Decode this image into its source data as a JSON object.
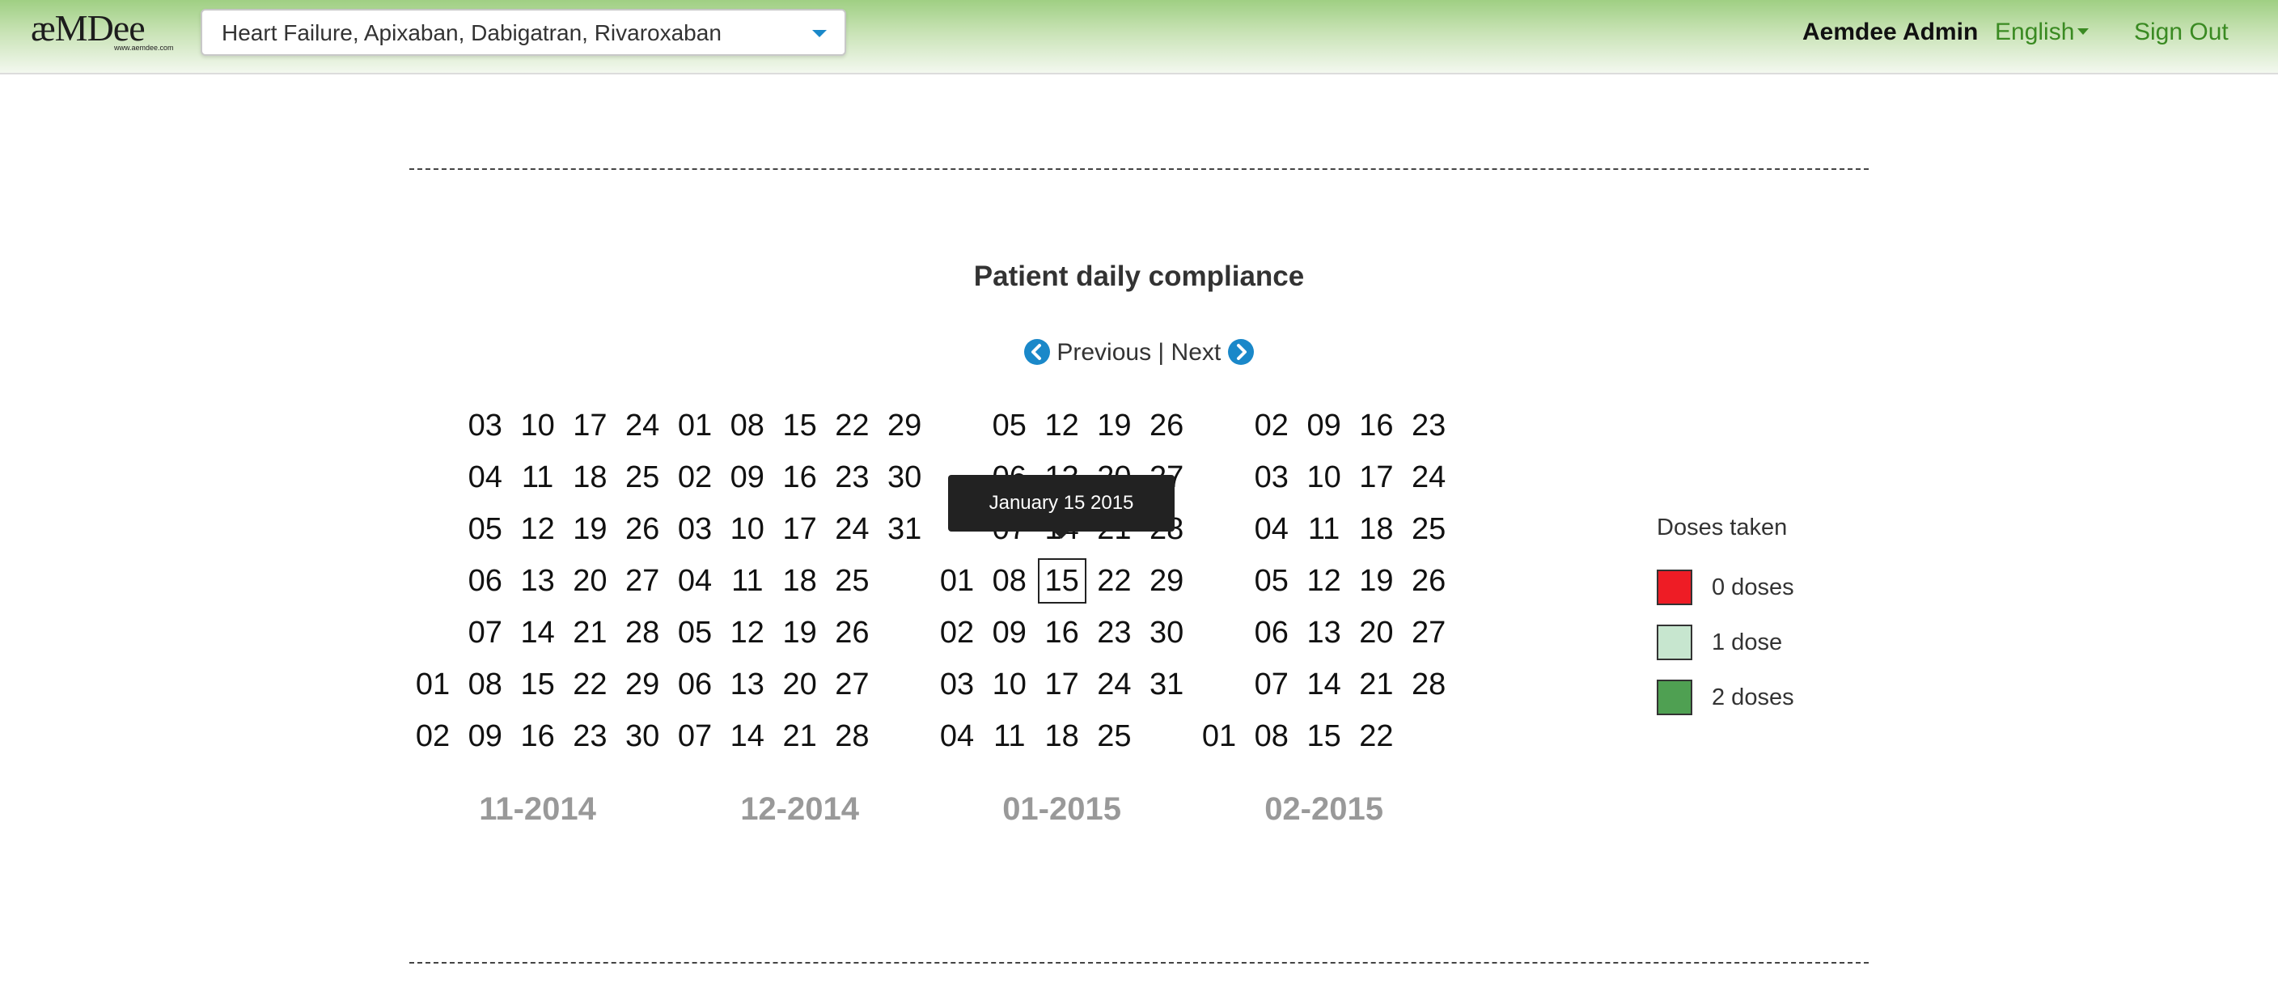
{
  "app": {
    "logo_text": "æMDee",
    "logo_url_text": "www.aemdee.com"
  },
  "header": {
    "medication_select_value": "Heart Failure, Apixaban, Dabigatran, Rivaroxaban",
    "user_name": "Aemdee Admin",
    "language": "English",
    "sign_out": "Sign Out"
  },
  "compliance": {
    "title": "Patient daily compliance",
    "previous": "Previous",
    "separator": "|",
    "next": "Next"
  },
  "calendar": {
    "months": [
      {
        "label": "11-2014",
        "weeks": [
          [
            null,
            null,
            null,
            null,
            null,
            "01",
            "02"
          ],
          [
            "03",
            "04",
            "05",
            "06",
            "07",
            "08",
            "09"
          ],
          [
            "10",
            "11",
            "12",
            "13",
            "14",
            "15",
            "16"
          ],
          [
            "17",
            "18",
            "19",
            "20",
            "21",
            "22",
            "23"
          ],
          [
            "24",
            "25",
            "26",
            "27",
            "28",
            "29",
            "30"
          ]
        ]
      },
      {
        "label": "12-2014",
        "weeks": [
          [
            "01",
            "02",
            "03",
            "04",
            "05",
            "06",
            "07"
          ],
          [
            "08",
            "09",
            "10",
            "11",
            "12",
            "13",
            "14"
          ],
          [
            "15",
            "16",
            "17",
            "18",
            "19",
            "20",
            "21"
          ],
          [
            "22",
            "23",
            "24",
            "25",
            "26",
            "27",
            "28"
          ],
          [
            "29",
            "30",
            "31",
            null,
            null,
            null,
            null
          ]
        ]
      },
      {
        "label": "01-2015",
        "weeks": [
          [
            null,
            null,
            null,
            "01",
            "02",
            "03",
            "04"
          ],
          [
            "05",
            "06",
            "07",
            "08",
            "09",
            "10",
            "11"
          ],
          [
            "12",
            "13",
            "14",
            "15",
            "16",
            "17",
            "18"
          ],
          [
            "19",
            "20",
            "21",
            "22",
            "23",
            "24",
            "25"
          ],
          [
            "26",
            "27",
            "28",
            "29",
            "30",
            "31",
            null
          ]
        ]
      },
      {
        "label": "02-2015",
        "weeks": [
          [
            null,
            null,
            null,
            null,
            null,
            null,
            "01"
          ],
          [
            "02",
            "03",
            "04",
            "05",
            "06",
            "07",
            "08"
          ],
          [
            "09",
            "10",
            "11",
            "12",
            "13",
            "14",
            "15"
          ],
          [
            "16",
            "17",
            "18",
            "19",
            "20",
            "21",
            "22"
          ],
          [
            "23",
            "24",
            "25",
            "26",
            "27",
            "28",
            null
          ]
        ]
      }
    ],
    "selected_day": "15",
    "tooltip": "January 15 2015"
  },
  "legend": {
    "title": "Doses taken",
    "items": [
      {
        "label": "0 doses",
        "color": "#ee1c25"
      },
      {
        "label": "1 dose",
        "color": "#c7e6cf"
      },
      {
        "label": "2 doses",
        "color": "#4fa052"
      }
    ]
  },
  "colors": {
    "accent_blue": "#1a88c9",
    "link_green": "#3a8a22",
    "month_label_gray": "#999999"
  }
}
